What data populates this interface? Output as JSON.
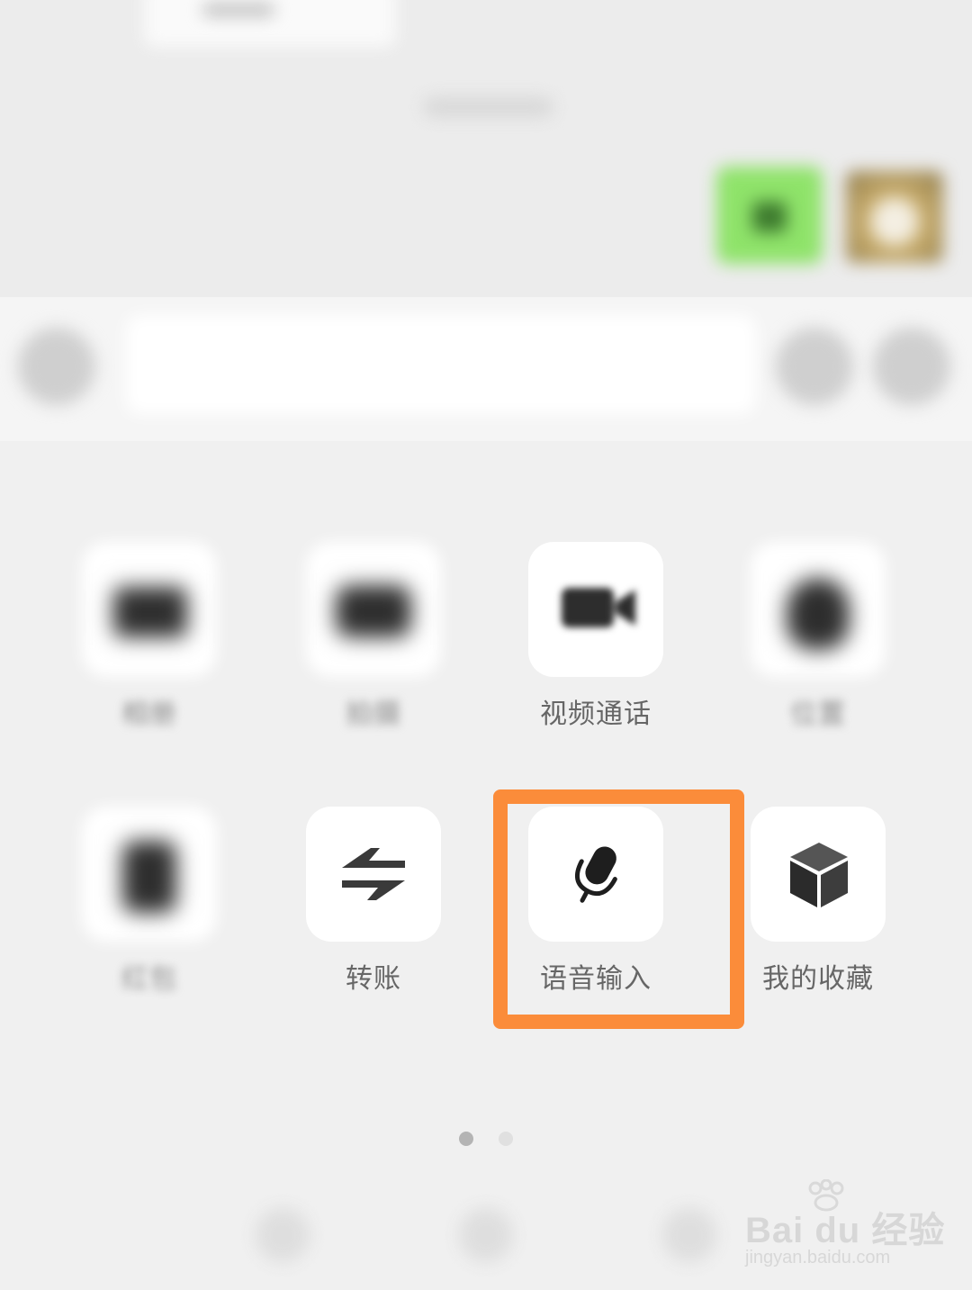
{
  "actions": {
    "row1": [
      {
        "label": "相册",
        "icon": "photo-icon",
        "blurred": true
      },
      {
        "label": "拍摄",
        "icon": "camera-icon",
        "blurred": true
      },
      {
        "label": "视频通话",
        "icon": "video-call-icon",
        "blurred": false
      },
      {
        "label": "位置",
        "icon": "location-icon",
        "blurred": true
      }
    ],
    "row2": [
      {
        "label": "红包",
        "icon": "red-packet-icon",
        "blurred": true
      },
      {
        "label": "转账",
        "icon": "transfer-icon",
        "blurred": false
      },
      {
        "label": "语音输入",
        "icon": "microphone-icon",
        "blurred": false,
        "highlighted": true
      },
      {
        "label": "我的收藏",
        "icon": "favorites-cube-icon",
        "blurred": false
      }
    ]
  },
  "pagination": {
    "total": 2,
    "current": 1
  },
  "colors": {
    "highlight": "#fb8c3a",
    "background": "#f0f0f0",
    "tile": "#ffffff",
    "label": "#666666"
  },
  "watermark": {
    "logo": "Bai du 经验",
    "url": "jingyan.baidu.com"
  }
}
